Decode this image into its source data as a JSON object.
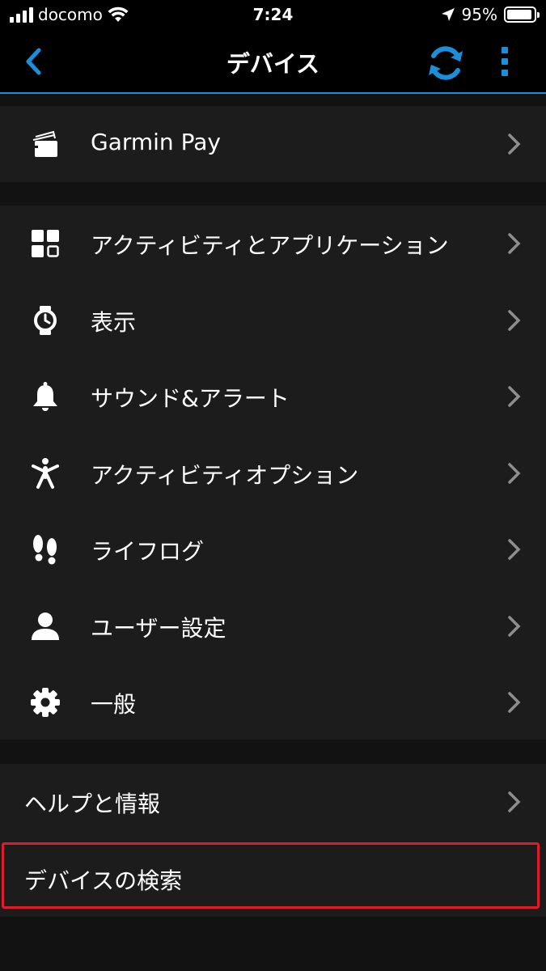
{
  "status_bar": {
    "carrier": "docomo",
    "time": "7:24",
    "battery_percent": "95%",
    "battery_level": 0.95
  },
  "navbar": {
    "title": "デバイス",
    "accent": "#1a8fdb"
  },
  "section1": {
    "items": [
      {
        "label": "Garmin Pay",
        "icon": "wallet-icon"
      }
    ]
  },
  "section2": {
    "items": [
      {
        "label": "アクティビティとアプリケーション",
        "icon": "grid-icon"
      },
      {
        "label": "表示",
        "icon": "watch-icon"
      },
      {
        "label": "サウンド&アラート",
        "icon": "bell-icon"
      },
      {
        "label": "アクティビティオプション",
        "icon": "person-active-icon"
      },
      {
        "label": "ライフログ",
        "icon": "footprints-icon"
      },
      {
        "label": "ユーザー設定",
        "icon": "user-icon"
      },
      {
        "label": "一般",
        "icon": "gear-icon"
      }
    ]
  },
  "section3": {
    "items": [
      {
        "label": "ヘルプと情報"
      },
      {
        "label": "デバイスの検索"
      }
    ]
  },
  "highlight_color": "#e0192b"
}
